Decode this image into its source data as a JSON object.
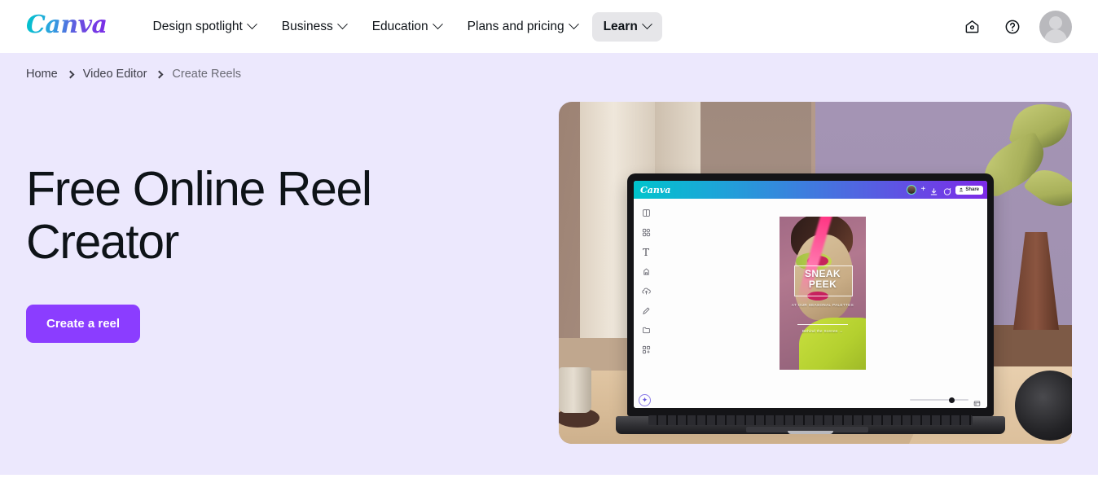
{
  "nav": {
    "logo_text": "Canva",
    "items": [
      {
        "label": "Design spotlight",
        "has_chevron": true,
        "active": false
      },
      {
        "label": "Business",
        "has_chevron": true,
        "active": false
      },
      {
        "label": "Education",
        "has_chevron": true,
        "active": false
      },
      {
        "label": "Plans and pricing",
        "has_chevron": true,
        "active": false
      },
      {
        "label": "Learn",
        "has_chevron": true,
        "active": true
      }
    ],
    "right_icons": [
      "home-icon",
      "help-icon",
      "avatar"
    ]
  },
  "breadcrumb": {
    "items": [
      {
        "label": "Home",
        "current": false
      },
      {
        "label": "Video Editor",
        "current": false
      },
      {
        "label": "Create Reels",
        "current": true
      }
    ]
  },
  "hero": {
    "title": "Free Online Reel Creator",
    "cta_label": "Create a reel",
    "background_color": "#ece8fd",
    "cta_color": "#8b3dff"
  },
  "hero_image": {
    "alt": "Laptop on a desk showing the Canva editor with a reel design open",
    "editor": {
      "logo_text": "Canva",
      "share_label": "Share",
      "rail_icons": [
        "design-icon",
        "elements-icon",
        "text-icon",
        "brand-icon",
        "uploads-icon",
        "draw-icon",
        "projects-icon",
        "apps-icon"
      ],
      "magic_icon": "magic-studio-icon",
      "zoom_percent": 66,
      "pages_icon": "pages-icon"
    },
    "design": {
      "headline_line1": "SNEAK",
      "headline_line2": "PEEK",
      "subtitle": "AT OUR SEASONAL PALETTES",
      "footer_text": "Behind the Scenes  →"
    }
  }
}
